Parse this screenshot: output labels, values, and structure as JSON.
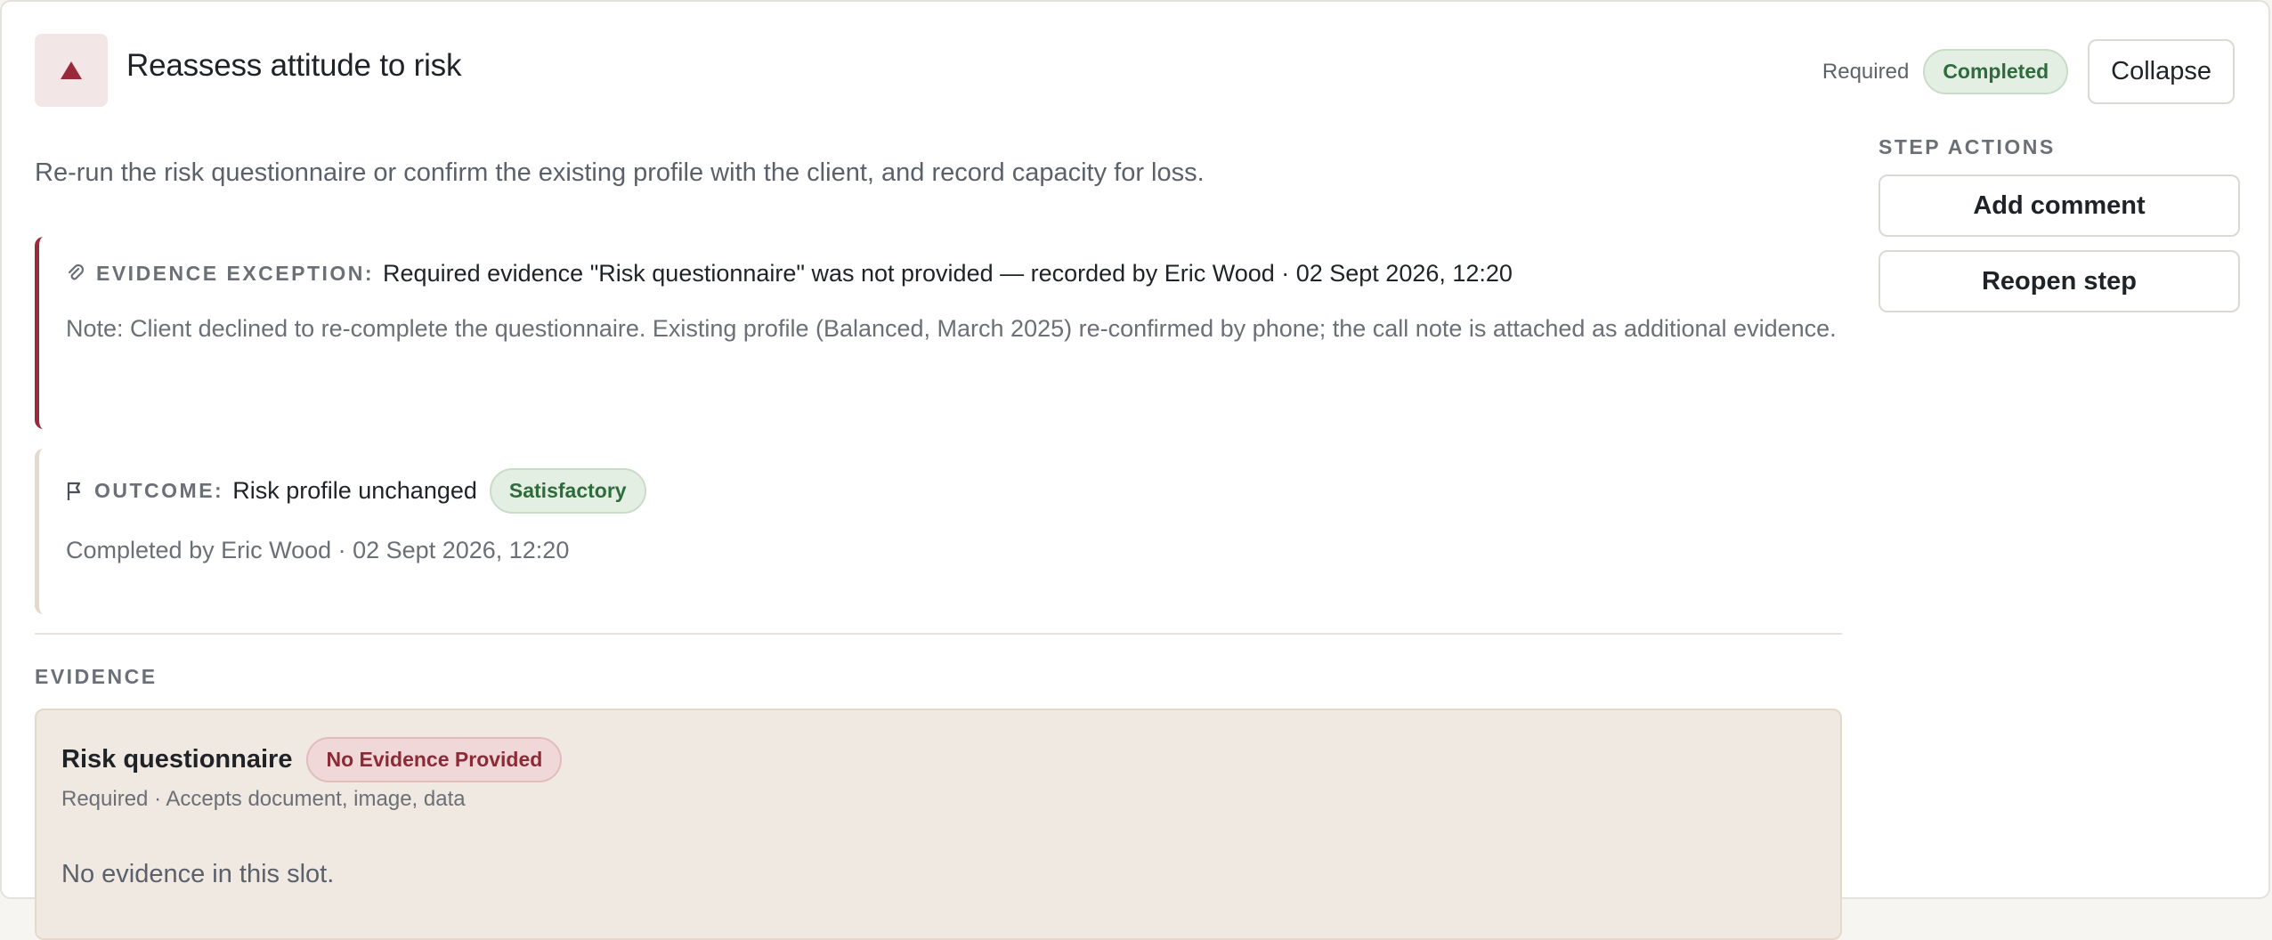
{
  "header": {
    "title": "Reassess attitude to risk",
    "required_label": "Required",
    "status": "Completed",
    "collapse_label": "Collapse",
    "icon": "triangle-up-icon",
    "accent_color": "#9a2a3a"
  },
  "description": "Re-run the risk questionnaire or confirm the existing profile with the client, and record capacity for loss.",
  "exception": {
    "icon": "paperclip-icon",
    "label": "EVIDENCE EXCEPTION:",
    "text": "Required evidence \"Risk questionnaire\" was not provided — recorded by Eric Wood · 02 Sept 2026, 12:20",
    "note": "Note: Client declined to re-complete the questionnaire. Existing profile (Balanced, March 2025) re-confirmed by phone; the call note is attached as additional evidence."
  },
  "outcome": {
    "icon": "flag-icon",
    "label": "OUTCOME:",
    "text": "Risk profile unchanged",
    "badge": "Satisfactory",
    "completed_by": "Completed by Eric Wood · 02 Sept 2026, 12:20"
  },
  "evidence": {
    "section_label": "EVIDENCE",
    "slots": [
      {
        "name": "Risk questionnaire",
        "badge": "No Evidence Provided",
        "subtitle": "Required · Accepts document, image, data",
        "empty_text": "No evidence in this slot."
      }
    ]
  },
  "actions": {
    "section_label": "STEP ACTIONS",
    "add_comment": "Add comment",
    "reopen": "Reopen step"
  }
}
